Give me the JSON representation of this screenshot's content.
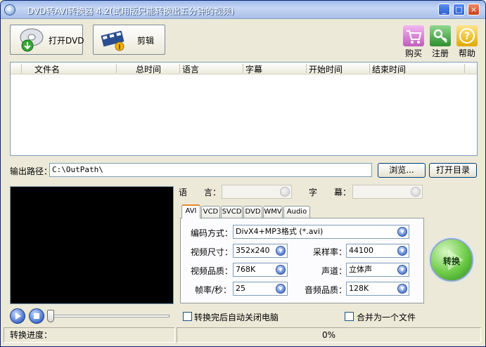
{
  "window": {
    "title": "DVD转AVI转换器 4.2(试用版只能转换出五分钟的视频)",
    "controls": [
      "_",
      "□",
      "×"
    ]
  },
  "toolbar": {
    "open_dvd": {
      "label": "打开DVD",
      "icon": "dvd-disc-icon"
    },
    "edit": {
      "label": "剪辑",
      "icon": "film-clapper-icon"
    },
    "buy": {
      "label": "购买",
      "icon": "shopping-cart-icon"
    },
    "register": {
      "label": "注册",
      "icon": "key-icon"
    },
    "help": {
      "label": "帮助",
      "icon": "help-icon"
    }
  },
  "file_list": {
    "columns": [
      "文件名",
      "总时间",
      "语言",
      "字幕",
      "开始时间",
      "结束时间"
    ],
    "rows": []
  },
  "output": {
    "label": "输出路径：",
    "path": "C:\\OutPath\\",
    "browse_label": "浏览...",
    "open_dir_label": "打开目录"
  },
  "source": {
    "language_label": "语　　言：",
    "language_value": "",
    "subtitle_label": "字　　幕：",
    "subtitle_value": ""
  },
  "format_tabs": {
    "tabs": [
      "AVI",
      "VCD",
      "SVCD",
      "DVD",
      "WMV",
      "Audio"
    ],
    "active": "AVI"
  },
  "settings": {
    "codec_label": "编码方式：",
    "codec_value": "DivX4+MP3格式 (*.avi)",
    "video_size_label": "视频尺寸：",
    "video_size_value": "352x240",
    "sample_rate_label": "采样率：",
    "sample_rate_value": "44100",
    "video_quality_label": "视频品质：",
    "video_quality_value": "768K",
    "channel_label": "声道：",
    "channel_value": "立体声",
    "fps_label": "帧率/秒：",
    "fps_value": "25",
    "audio_quality_label": "音频品质：",
    "audio_quality_value": "128K"
  },
  "convert": {
    "label": "转换"
  },
  "player": {
    "seek_fraction": 0.0
  },
  "options": {
    "shutdown_label": "转换完后自动关闭电脑",
    "shutdown_checked": false,
    "merge_label": "合并为一个文件",
    "merge_checked": false
  },
  "status": {
    "progress_label": "转换进度：",
    "progress_text": "0%",
    "progress_fraction": 0.0
  },
  "colors": {
    "face": "#ece9d8",
    "titlebar": "#c6d6f4",
    "preview_bg": "#000000",
    "convert_green": "#6ccb46"
  }
}
